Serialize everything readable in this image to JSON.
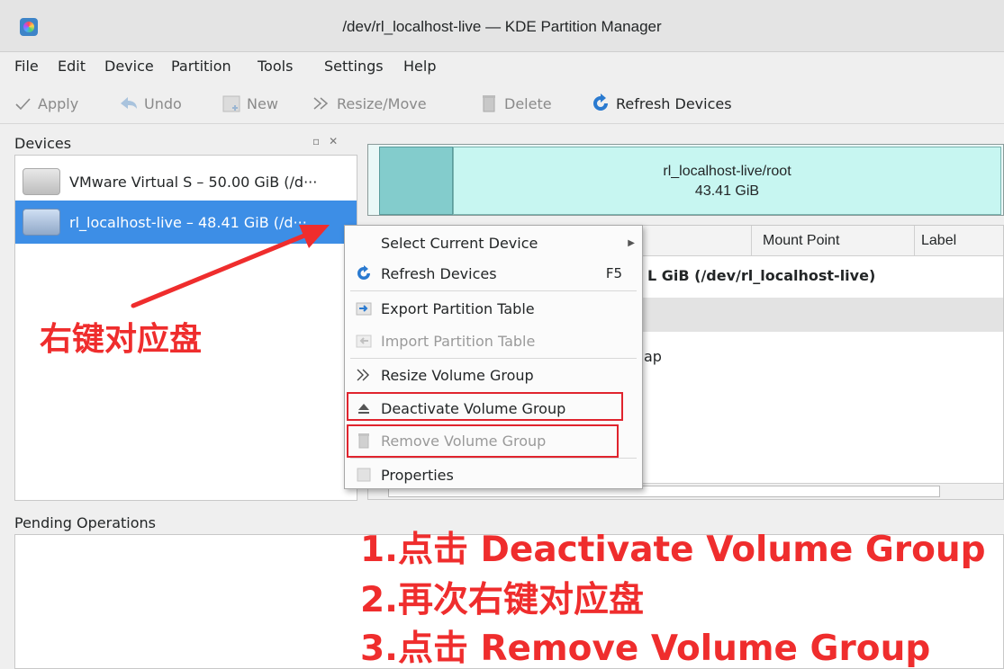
{
  "window": {
    "title": "/dev/rl_localhost-live — KDE Partition Manager"
  },
  "menubar": {
    "items": [
      {
        "label": "File"
      },
      {
        "label": "Edit"
      },
      {
        "label": "Device"
      },
      {
        "label": "Partition"
      },
      {
        "label": "Tools"
      },
      {
        "label": "Settings"
      },
      {
        "label": "Help"
      }
    ]
  },
  "toolbar": {
    "apply": "Apply",
    "undo": "Undo",
    "new": "New",
    "resize_move": "Resize/Move",
    "delete": "Delete",
    "refresh_devices": "Refresh Devices"
  },
  "devices_panel": {
    "title": "Devices",
    "items": [
      {
        "label": "VMware Virtual S – 50.00 GiB (/d···"
      },
      {
        "label": "rl_localhost-live – 48.41 GiB (/d···",
        "selected": true
      }
    ]
  },
  "partition_graph": {
    "name": "rl_localhost-live/root",
    "size": "43.41 GiB"
  },
  "partition_table": {
    "columns": [
      "Mount Point",
      "Label"
    ],
    "device_row": "L GiB (/dev/rl_localhost-live)",
    "swap_fragment": "ap"
  },
  "context_menu": {
    "items": [
      {
        "label": "Select Current Device",
        "submenu": true
      },
      {
        "label": "Refresh Devices",
        "shortcut": "F5"
      },
      {
        "label": "Export Partition Table"
      },
      {
        "label": "Import Partition Table",
        "disabled": true
      },
      {
        "label": "Resize Volume Group"
      },
      {
        "label": "Deactivate Volume Group"
      },
      {
        "label": "Remove Volume Group",
        "disabled": true
      },
      {
        "label": "Properties"
      }
    ]
  },
  "pending_panel": {
    "title": "Pending Operations"
  },
  "annotations": {
    "right_click_hint": "右键对应盘",
    "steps": [
      "1.点击 Deactivate Volume Group",
      "2.再次右键对应盘",
      "3.点击 Remove  Volume Group"
    ],
    "color": "#ef2d2d"
  }
}
